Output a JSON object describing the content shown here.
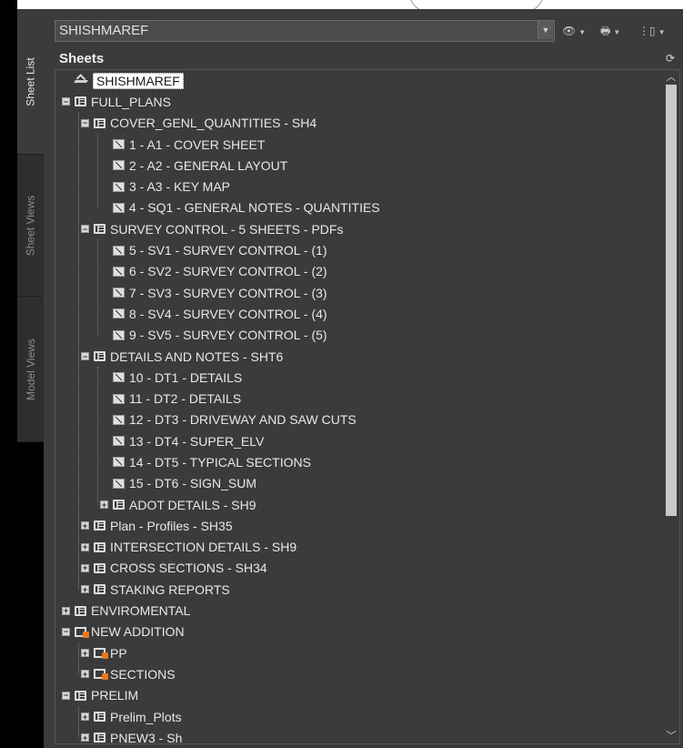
{
  "side_tabs": [
    {
      "label": "Sheet List",
      "active": true
    },
    {
      "label": "Sheet Views",
      "active": false
    },
    {
      "label": "Model Views",
      "active": false
    }
  ],
  "header": {
    "project_name": "SHISHMAREF",
    "tools": [
      {
        "icon": "eye-icon"
      },
      {
        "icon": "print-icon"
      },
      {
        "icon": "layout-icon"
      }
    ]
  },
  "panel": {
    "title": "Sheets"
  },
  "tree": [
    {
      "label": "SHISHMAREF",
      "level": 0,
      "icon": "root",
      "selected": true
    },
    {
      "label": "FULL_PLANS",
      "level": 0,
      "toggle": "minus",
      "icon": "set"
    },
    {
      "label": "COVER_GENL_QUANTITIES - SH4",
      "level": 1,
      "toggle": "minus",
      "icon": "set"
    },
    {
      "label": "1 - A1 - COVER SHEET",
      "level": 2,
      "icon": "sheet"
    },
    {
      "label": "2 - A2 - GENERAL LAYOUT",
      "level": 2,
      "icon": "sheet"
    },
    {
      "label": "3 - A3 - KEY MAP",
      "level": 2,
      "icon": "sheet"
    },
    {
      "label": "4 - SQ1 - GENERAL NOTES - QUANTITIES",
      "level": 2,
      "icon": "sheet"
    },
    {
      "label": "SURVEY CONTROL - 5 SHEETS - PDFs",
      "level": 1,
      "toggle": "minus",
      "icon": "set"
    },
    {
      "label": "5 - SV1 - SURVEY CONTROL - (1)",
      "level": 2,
      "icon": "sheet"
    },
    {
      "label": "6 - SV2 - SURVEY CONTROL - (2)",
      "level": 2,
      "icon": "sheet"
    },
    {
      "label": "7 - SV3 - SURVEY CONTROL - (3)",
      "level": 2,
      "icon": "sheet"
    },
    {
      "label": "8 - SV4 - SURVEY CONTROL - (4)",
      "level": 2,
      "icon": "sheet"
    },
    {
      "label": "9 - SV5 - SURVEY CONTROL - (5)",
      "level": 2,
      "icon": "sheet"
    },
    {
      "label": "DETAILS AND NOTES - SHT6",
      "level": 1,
      "toggle": "minus",
      "icon": "set"
    },
    {
      "label": "10 - DT1 - DETAILS",
      "level": 2,
      "icon": "sheet"
    },
    {
      "label": "11 - DT2 - DETAILS",
      "level": 2,
      "icon": "sheet"
    },
    {
      "label": "12 - DT3 - DRIVEWAY AND SAW CUTS",
      "level": 2,
      "icon": "sheet"
    },
    {
      "label": "13 - DT4 - SUPER_ELV",
      "level": 2,
      "icon": "sheet"
    },
    {
      "label": "14 - DT5 - TYPICAL SECTIONS",
      "level": 2,
      "icon": "sheet"
    },
    {
      "label": "15 - DT6 - SIGN_SUM",
      "level": 2,
      "icon": "sheet"
    },
    {
      "label": "ADOT DETAILS - SH9",
      "level": 2,
      "toggle": "plus",
      "icon": "set"
    },
    {
      "label": "Plan - Profiles - SH35",
      "level": 1,
      "toggle": "plus",
      "icon": "set"
    },
    {
      "label": "INTERSECTION DETAILS - SH9",
      "level": 1,
      "toggle": "plus",
      "icon": "set"
    },
    {
      "label": "CROSS SECTIONS - SH34",
      "level": 1,
      "toggle": "plus",
      "icon": "set"
    },
    {
      "label": "STAKING REPORTS",
      "level": 1,
      "toggle": "plus",
      "icon": "set"
    },
    {
      "label": "ENVIROMENTAL",
      "level": 0,
      "toggle": "plus",
      "icon": "set"
    },
    {
      "label": "NEW ADDITION",
      "level": 0,
      "toggle": "minus",
      "icon": "orange"
    },
    {
      "label": "PP",
      "level": 1,
      "toggle": "plus",
      "icon": "orange"
    },
    {
      "label": "SECTIONS",
      "level": 1,
      "toggle": "plus",
      "icon": "orange"
    },
    {
      "label": "PRELIM",
      "level": 0,
      "toggle": "minus",
      "icon": "set"
    },
    {
      "label": "Prelim_Plots",
      "level": 1,
      "toggle": "plus",
      "icon": "set"
    },
    {
      "label": "PNEW3 - Sh",
      "level": 1,
      "toggle": "plus",
      "icon": "set"
    }
  ],
  "scrollbar": {
    "position": 0.0,
    "visible_fraction": 0.67
  },
  "colors": {
    "panel_bg": "#3b3b3b",
    "text": "#e8e8e8",
    "selection_bg": "#ffffff",
    "accent_orange": "#e8781e"
  }
}
